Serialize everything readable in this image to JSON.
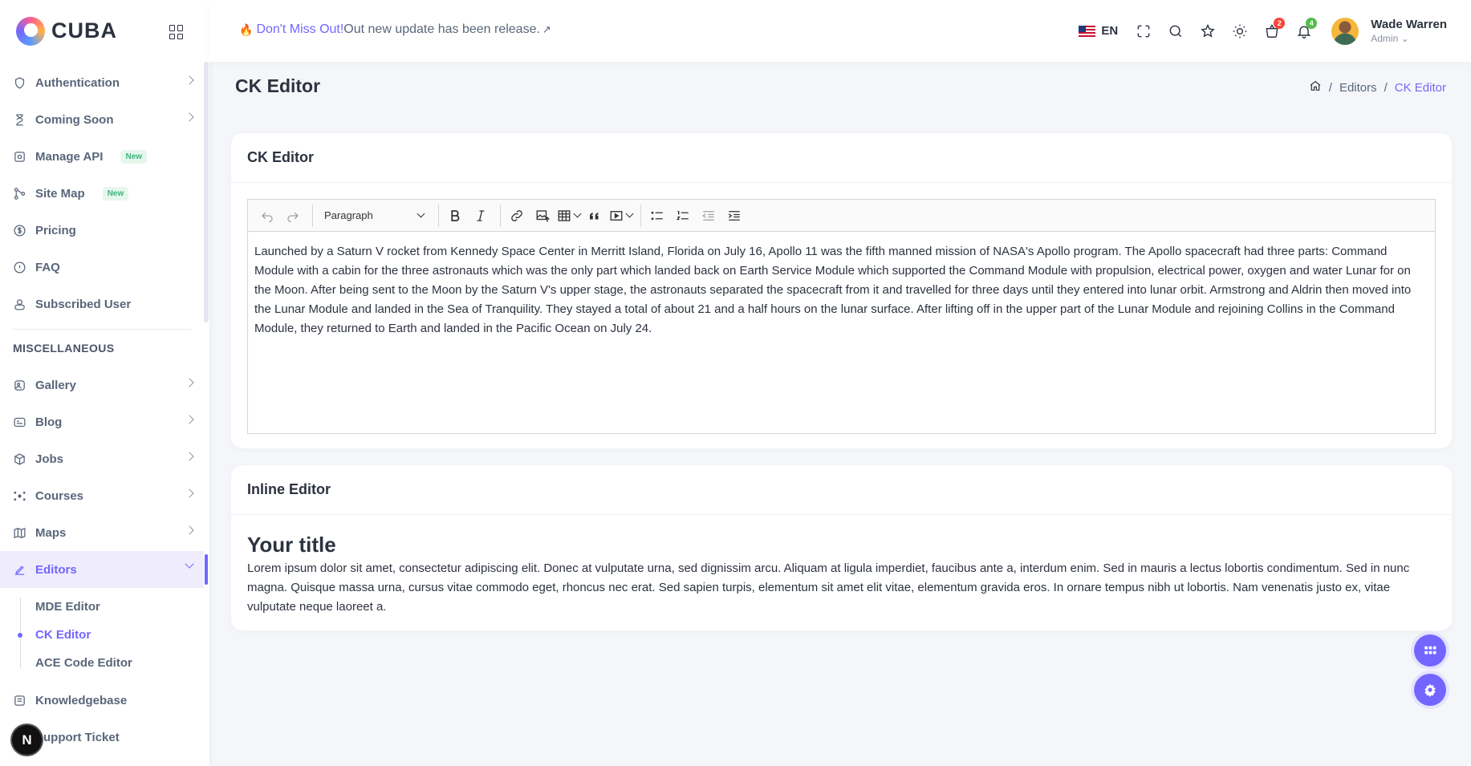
{
  "brand": {
    "name": "CUBA"
  },
  "sidebar": {
    "items_top": [
      {
        "label": "Authentication",
        "icon": "shield-icon",
        "has_children": true
      },
      {
        "label": "Coming Soon",
        "icon": "hourglass-icon",
        "has_children": true
      },
      {
        "label": "Manage API",
        "icon": "api-icon",
        "badge": "New"
      },
      {
        "label": "Site Map",
        "icon": "sitemap-icon",
        "badge": "New"
      },
      {
        "label": "Pricing",
        "icon": "pricing-icon"
      },
      {
        "label": "FAQ",
        "icon": "info-icon"
      },
      {
        "label": "Subscribed User",
        "icon": "user-icon"
      }
    ],
    "section_title": "MISCELLANEOUS",
    "items_misc": [
      {
        "label": "Gallery",
        "icon": "gallery-icon",
        "has_children": true
      },
      {
        "label": "Blog",
        "icon": "blog-icon",
        "has_children": true
      },
      {
        "label": "Jobs",
        "icon": "jobs-icon",
        "has_children": true
      },
      {
        "label": "Courses",
        "icon": "courses-icon",
        "has_children": true
      },
      {
        "label": "Maps",
        "icon": "map-icon",
        "has_children": true
      }
    ],
    "active_item": {
      "label": "Editors",
      "icon": "pen-icon"
    },
    "submenu": [
      "MDE Editor",
      "CK Editor",
      "ACE Code Editor"
    ],
    "submenu_active": "CK Editor",
    "items_bottom": [
      {
        "label": "Knowledgebase",
        "icon": "knowledge-icon"
      },
      {
        "label": "Support Ticket",
        "icon": "ticket-icon"
      }
    ],
    "next_badge": "N"
  },
  "header": {
    "announce_highlight": "Don't Miss Out!",
    "announce_text": "Out new update has been release.",
    "arrow": "↗",
    "language": "EN",
    "cart_count": "2",
    "notification_count": "4",
    "user_name": "Wade Warren",
    "user_role": "Admin"
  },
  "page": {
    "title": "CK Editor",
    "breadcrumb": [
      "Editors",
      "CK Editor"
    ]
  },
  "ck_card": {
    "title": "CK Editor",
    "paragraph_select": "Paragraph",
    "content": "Launched by a Saturn V rocket from Kennedy Space Center in Merritt Island, Florida on July 16, Apollo 11 was the fifth manned mission of NASA's Apollo program. The Apollo spacecraft had three parts: Command Module with a cabin for the three astronauts which was the only part which landed back on Earth Service Module which supported the Command Module with propulsion, electrical power, oxygen and water Lunar for on the Moon. After being sent to the Moon by the Saturn V's upper stage, the astronauts separated the spacecraft from it and travelled for three days until they entered into lunar orbit. Armstrong and Aldrin then moved into the Lunar Module and landed in the Sea of Tranquility. They stayed a total of about 21 and a half hours on the lunar surface. After lifting off in the upper part of the Lunar Module and rejoining Collins in the Command Module, they returned to Earth and landed in the Pacific Ocean on July 24."
  },
  "inline_card": {
    "title": "Inline Editor",
    "heading": "Your title",
    "content": "Lorem ipsum dolor sit amet, consectetur adipiscing elit. Donec at vulputate urna, sed dignissim arcu. Aliquam at ligula imperdiet, faucibus ante a, interdum enim. Sed in mauris a lectus lobortis condimentum. Sed in nunc magna. Quisque massa urna, cursus vitae commodo eget, rhoncus nec erat. Sed sapien turpis, elementum sit amet elit vitae, elementum gravida eros. In ornare tempus nibh ut lobortis. Nam venenatis justo ex, vitae vulputate neque laoreet a."
  },
  "colors": {
    "accent": "#7366ff",
    "badge_red": "#fc4438",
    "badge_green": "#54ba4a"
  }
}
